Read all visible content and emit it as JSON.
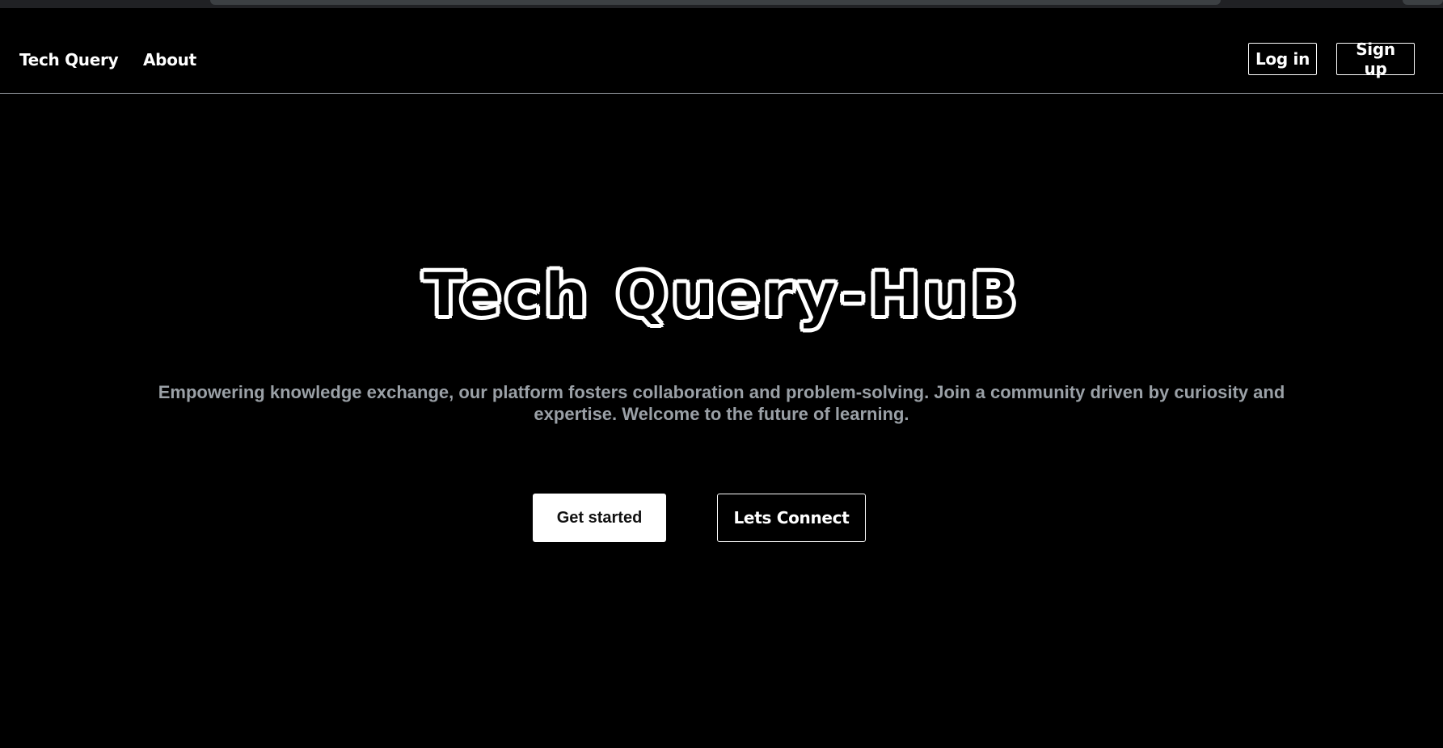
{
  "nav": {
    "brand": "Tech Query",
    "about": "About",
    "login": "Log in",
    "signup": "Sign up"
  },
  "hero": {
    "title": "Tech Query-HuB",
    "subtitle": "Empowering knowledge exchange, our platform fosters collaboration and problem-solving. Join a community driven by curiosity and expertise. Welcome to the future of learning.",
    "primary_cta": "Get started",
    "secondary_cta": "Lets Connect"
  },
  "colors": {
    "background": "#000000",
    "text": "#ffffff",
    "muted_text": "#9aa0a6",
    "primary_button_bg": "#ffffff"
  }
}
